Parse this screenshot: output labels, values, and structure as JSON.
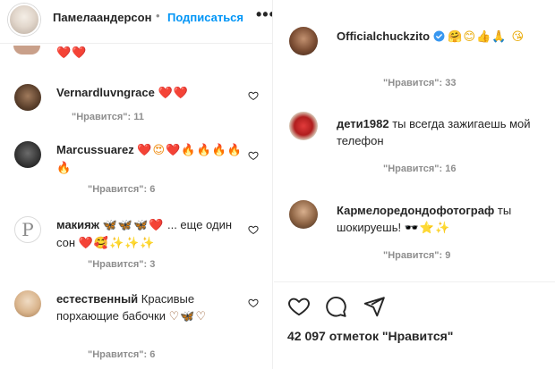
{
  "header": {
    "username": "Памелаандерсон",
    "separator": "•",
    "follow_label": "Подписаться",
    "more_label": "•••"
  },
  "left_comments": [
    {
      "username": "Vernardluvngrace",
      "text": "",
      "emoji": "❤️❤️",
      "meta": "\"Нравится\": 11"
    },
    {
      "username": "Marcussuarez",
      "text": "",
      "emoji": "❤️😍❤️🔥🔥🔥🔥🔥",
      "meta": "\"Нравится\": 6"
    },
    {
      "username": "макияж",
      "text": "... еще один сон",
      "emoji_before": "🦋🦋🦋❤️",
      "emoji_after": "❤️🥰✨✨✨",
      "meta": "\"Нравится\": 3"
    },
    {
      "username": "естественный",
      "text": "Красивые порхающие бабочки",
      "emoji": "♡🦋♡",
      "meta": "\"Нравится\": 6"
    }
  ],
  "right_comments": [
    {
      "username": "Officialchuckzito",
      "emoji": "🤗😊👍🙏 😘",
      "meta": "\"Нравится\": 33"
    },
    {
      "username": "дети1982",
      "text": "ты всегда зажигаешь мой телефон",
      "meta": "\"Нравится\": 16"
    },
    {
      "username": "Кармелоредондофотограф",
      "text": "ты шокируешь!",
      "emoji": "🕶️⭐✨",
      "meta": "\"Нравится\": 9"
    }
  ],
  "actions": {
    "icons": [
      "heart-icon",
      "comment-icon",
      "share-icon"
    ],
    "likes_label": "42 097 отметок \"Нравится\""
  },
  "colors": {
    "accent": "#0095f6",
    "verified": "#3897f0",
    "heart": "#ed4956",
    "meta": "#8e8e8e"
  }
}
